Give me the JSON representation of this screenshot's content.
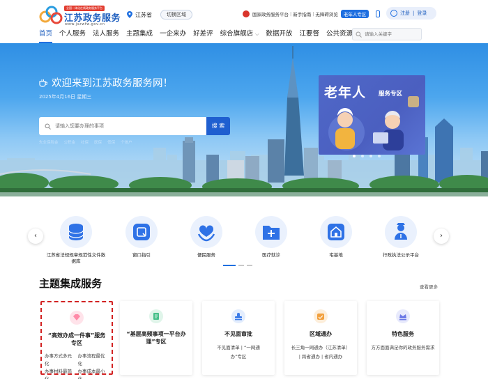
{
  "header": {
    "logo_tag": "全国一体化在线政务服务平台",
    "logo_name": "江苏政务服务",
    "logo_url": "www.jszwfw.gov.cn",
    "location": "江苏省",
    "switch_area": "切换区域",
    "links": [
      "国家政务服务平台",
      "新手指南",
      "无障碍浏览"
    ],
    "elder_zone": "老年人专区",
    "login": "注册",
    "register": "登录"
  },
  "nav": {
    "items": [
      "首页",
      "个人服务",
      "法人服务",
      "主题集成",
      "一企来办",
      "好差评",
      "综合旗舰店",
      "数据开放",
      "江要督",
      "公共资源交易"
    ],
    "active": "首页",
    "search_placeholder": "请输入关键字"
  },
  "banner": {
    "welcome": "欢迎来到江苏政务服务网！",
    "date": "2025年4月16日 星期三",
    "search_placeholder": "请输入您要办理的事项",
    "search_button": "搜 索",
    "hot_words": [
      "失业保险金",
      "公积金",
      "社保",
      "医保",
      "低保",
      "个体户"
    ],
    "elder_title": "老年人",
    "elder_sub": "服务专区"
  },
  "services": [
    {
      "label": "江苏省法规规章规范性文件数据库",
      "icon": "database-icon"
    },
    {
      "label": "窗口指引",
      "icon": "window-guide-icon"
    },
    {
      "label": "便民服务",
      "icon": "heart-hands-icon"
    },
    {
      "label": "医疗就诊",
      "icon": "medical-folder-icon"
    },
    {
      "label": "宅基地",
      "icon": "house-icon"
    },
    {
      "label": "行政执法公示平台",
      "icon": "officer-icon"
    }
  ],
  "theme": {
    "title": "主题集成服务",
    "more": "查看更多",
    "cards": [
      {
        "title": "“高效办成一件事”服务专区",
        "desc": [
          "办事方式多元化",
          "办事流程最优化",
          "办事材料最简化",
          "办事成本最小化"
        ],
        "color": "#ff8aa8"
      },
      {
        "title": "“基层高频事项一平台办理”专区",
        "desc": [],
        "color": "#47c08a"
      },
      {
        "title": "不见面审批",
        "desc": [
          "不见面清单 | “一网通",
          "办”专区"
        ],
        "color": "#3b7be8"
      },
      {
        "title": "区域通办",
        "desc": [
          "长三角一网通办（江苏清单）",
          "| 跨省通办 | 省内通办"
        ],
        "color": "#f2a03d"
      },
      {
        "title": "特色服务",
        "desc": [
          "方方面面满足你的政务服务需求"
        ],
        "color": "#6b78e6"
      }
    ]
  }
}
